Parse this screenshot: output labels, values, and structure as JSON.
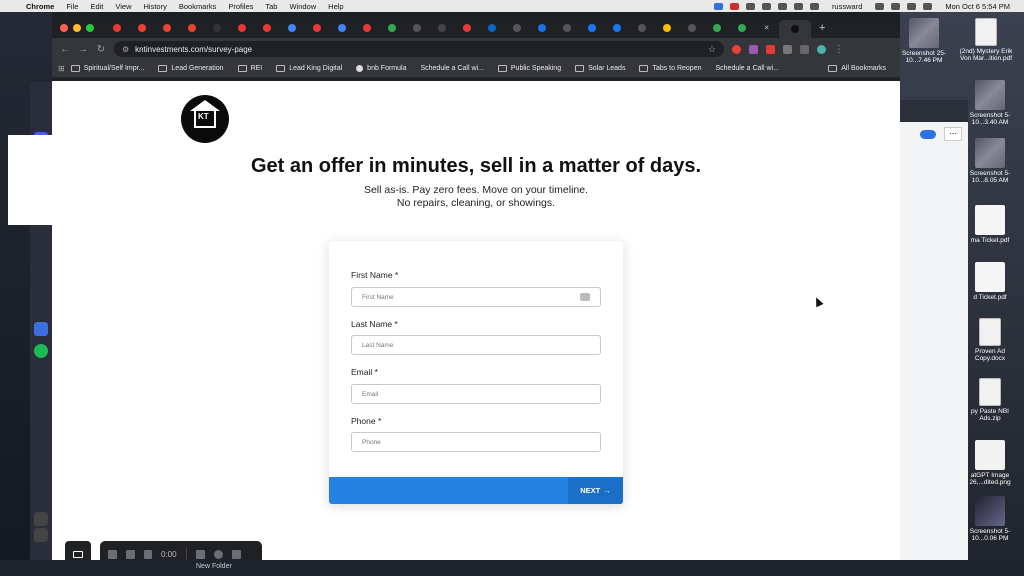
{
  "menubar": {
    "app_name": "Chrome",
    "items": [
      "File",
      "Edit",
      "View",
      "History",
      "Bookmarks",
      "Profiles",
      "Tab",
      "Window",
      "Help"
    ],
    "user": "russward",
    "datetime": "Mon Oct 6  5:54 PM"
  },
  "browser": {
    "url": "kntinvestments.com/survey-page",
    "bookmarks": [
      "Spiritual/Self Impr...",
      "Lead Generation",
      "REI",
      "Lead King Digital",
      "bnb Formula",
      "Schedule a Call wi...",
      "Public Speaking",
      "Solar Leads",
      "Tabs to Reopen",
      "Schedule a Call wi..."
    ],
    "all_bookmarks": "All Bookmarks"
  },
  "page": {
    "logo_text": "KT",
    "headline": "Get an offer in minutes, sell in a matter of days.",
    "subline1": "Sell as-is. Pay zero fees. Move on your timeline.",
    "subline2": "No repairs, cleaning, or showings."
  },
  "form": {
    "first_name": {
      "label": "First Name *",
      "placeholder": "First Name"
    },
    "last_name": {
      "label": "Last Name *",
      "placeholder": "Last Name"
    },
    "email": {
      "label": "Email *",
      "placeholder": "Email"
    },
    "phone": {
      "label": "Phone *",
      "placeholder": "Phone"
    },
    "next_label": "NEXT",
    "next_arrow": "→"
  },
  "recorder": {
    "time": "0:00"
  },
  "desktop": {
    "files": [
      {
        "name": "Screenshot 25-10...7.46 PM"
      },
      {
        "name": "(2nd) Mystery Erik Von Mar...ition.pdf"
      },
      {
        "name": "Screenshot 5-10...3.40 AM"
      },
      {
        "name": "Screenshot 5-10...8.05 AM"
      },
      {
        "name": "ma Ticket.pdf"
      },
      {
        "name": "d Ticket.pdf"
      },
      {
        "name": "Proven Ad Copy.docx"
      },
      {
        "name": "py Paste NBI Ads.zip"
      },
      {
        "name": "atGPT Image 26,...dited.png"
      },
      {
        "name": "Screenshot 5-10...0.06 PM"
      }
    ],
    "bottom_folder": "New Folder"
  }
}
